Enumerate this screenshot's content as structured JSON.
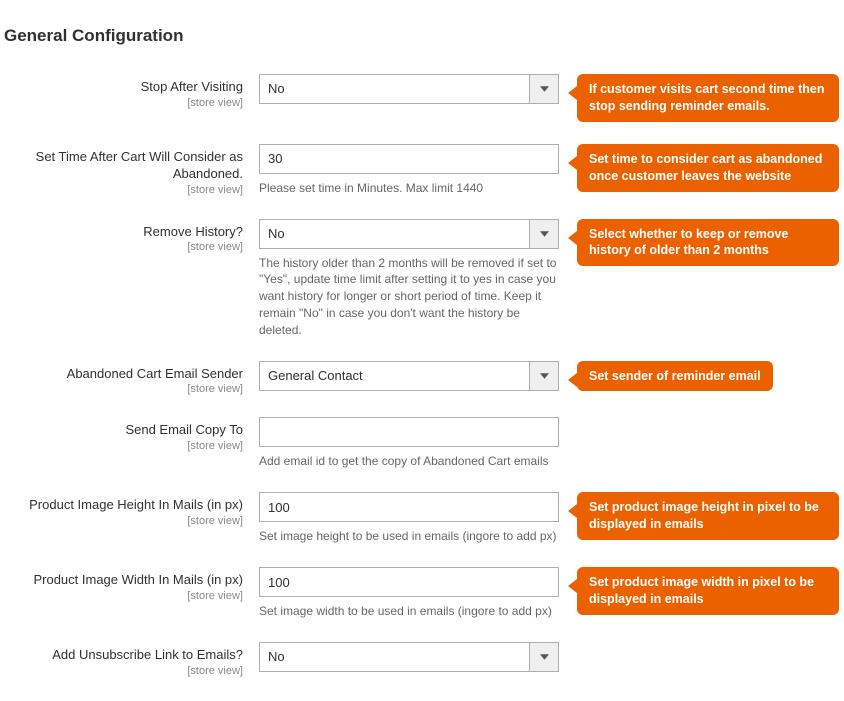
{
  "section_title": "General Configuration",
  "scope_label": "[store view]",
  "fields": {
    "stop_after": {
      "label": "Stop After Visiting",
      "value": "No",
      "callout": "If customer visits cart second time then stop sending reminder emails."
    },
    "set_time": {
      "label": "Set Time After Cart Will Consider as Abandoned.",
      "value": "30",
      "help": "Please set time in Minutes. Max limit 1440",
      "callout": "Set time to consider cart as abandoned once customer leaves the website"
    },
    "remove_history": {
      "label": "Remove History?",
      "value": "No",
      "help": "The history older than 2 months will be removed if set to \"Yes\", update time limit after setting it to yes in case you want history for longer or short period of time. Keep it remain \"No\" in case you don't want the history be deleted.",
      "callout": "Select whether to keep or remove history of older than 2 months"
    },
    "email_sender": {
      "label": "Abandoned Cart Email Sender",
      "value": "General Contact",
      "callout": "Set sender of reminder email"
    },
    "email_copy": {
      "label": "Send Email Copy To",
      "value": "",
      "help": "Add email id to get the copy of Abandoned Cart emails"
    },
    "img_height": {
      "label": "Product Image Height In Mails (in px)",
      "value": "100",
      "help": "Set image height to be used in emails (ingore to add px)",
      "callout": "Set product image height in pixel to be displayed in emails"
    },
    "img_width": {
      "label": "Product Image Width In Mails (in px)",
      "value": "100",
      "help": "Set image width to be used in emails (ingore to add px)",
      "callout": "Set product image width in pixel to be displayed in emails"
    },
    "unsubscribe": {
      "label": "Add Unsubscribe Link to Emails?",
      "value": "No"
    }
  }
}
